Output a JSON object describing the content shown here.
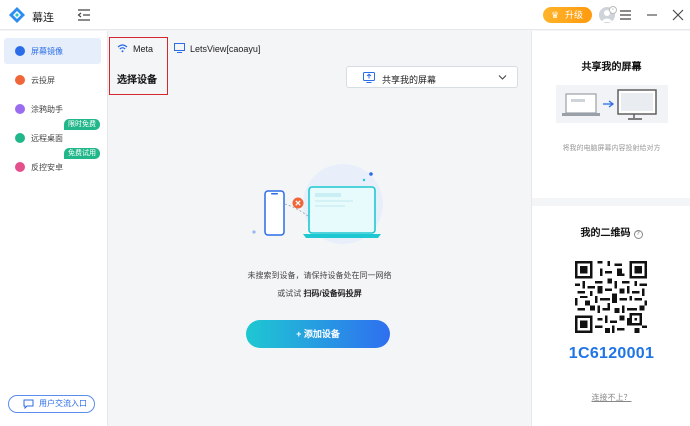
{
  "app": {
    "name": "幕连",
    "upgrade_label": "升级"
  },
  "sidebar": {
    "items": [
      {
        "label": "屏幕镜像",
        "icon": "screen-mirror-icon",
        "color": "#2b6de6",
        "active": true
      },
      {
        "label": "云投屏",
        "icon": "cloud-cast-icon",
        "color": "#f0663a",
        "active": false
      },
      {
        "label": "涂鸦助手",
        "icon": "doodle-icon",
        "color": "#9b6cf0",
        "active": false
      },
      {
        "label": "远程桌面",
        "icon": "remote-desktop-icon",
        "color": "#22b78a",
        "active": false,
        "badge": "限时免费"
      },
      {
        "label": "反控安卓",
        "icon": "reverse-control-icon",
        "color": "#e4508c",
        "active": false,
        "badge": "免费试用"
      }
    ],
    "community_label": "用户交流入口"
  },
  "main": {
    "tabs": [
      {
        "label": "Meta",
        "icon": "wifi-icon"
      },
      {
        "label": "LetsView[caoayu]",
        "icon": "monitor-icon"
      }
    ],
    "select_device_label": "选择设备",
    "share_dropdown_label": "共享我的屏幕",
    "hint_line1": "未搜索到设备，请保持设备处在同一网络",
    "hint_line2_prefix": "或试试 ",
    "hint_line2_bold": "扫码/设备码投屏",
    "add_device_label": "+ 添加设备"
  },
  "right": {
    "share_title": "共享我的屏幕",
    "share_desc": "将我的电脑屏幕内容投射给对方",
    "qr_title": "我的二维码",
    "device_code": "1C6120001",
    "trouble_link": "连接不上？"
  },
  "colors": {
    "accent": "#2b6de6",
    "code": "#1f74e6",
    "upgrade": "#ff9a0e",
    "highlight_box": "#d6262d"
  }
}
